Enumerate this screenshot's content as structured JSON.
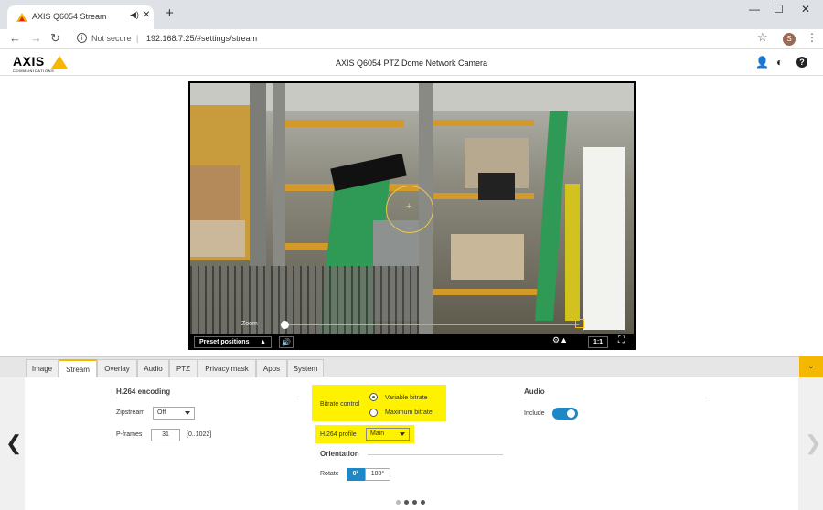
{
  "browser": {
    "tab_title": "AXIS Q6054 Stream",
    "speaker_icon": "speaker-icon",
    "close_glyph": "✕",
    "newtab_glyph": "+",
    "security": "Not secure",
    "url": "192.168.7.25/#settings/stream",
    "profile_initial": "S"
  },
  "app": {
    "brand": "AXIS",
    "brand_sub": "COMMUNICATIONS",
    "product_title": "AXIS Q6054 PTZ Dome Network Camera",
    "help_glyph": "?"
  },
  "video": {
    "zoom_label": "Zoom",
    "preset_label": "Preset positions",
    "ratio_label": "1:1",
    "zoom_level": 0.0
  },
  "tabs": [
    {
      "label": "Image",
      "active": false
    },
    {
      "label": "Stream",
      "active": true
    },
    {
      "label": "Overlay",
      "active": false
    },
    {
      "label": "Audio",
      "active": false
    },
    {
      "label": "PTZ",
      "active": false
    },
    {
      "label": "Privacy mask",
      "active": false
    },
    {
      "label": "Apps",
      "active": false
    },
    {
      "label": "System",
      "active": false
    }
  ],
  "h264": {
    "heading": "H.264 encoding",
    "zipstream_label": "Zipstream",
    "zipstream_value": "Off",
    "pframes_label": "P-frames",
    "pframes_value": "31",
    "pframes_range": "[0..1022]",
    "bitrate_label": "Bitrate control",
    "bitrate_options": [
      "Variable bitrate",
      "Maximum bitrate"
    ],
    "bitrate_selected": "Variable bitrate",
    "profile_label": "H.264 profile",
    "profile_value": "Main"
  },
  "orientation": {
    "heading": "Orientation",
    "rotate_label": "Rotate",
    "options": [
      "0°",
      "180°"
    ],
    "selected": "0°"
  },
  "audio": {
    "heading": "Audio",
    "include_label": "Include",
    "include_on": true
  },
  "pager": {
    "count": 4,
    "active": 0
  },
  "colors": {
    "accent": "#f5b800",
    "highlight": "#fff200",
    "toggle": "#1e88c7"
  }
}
